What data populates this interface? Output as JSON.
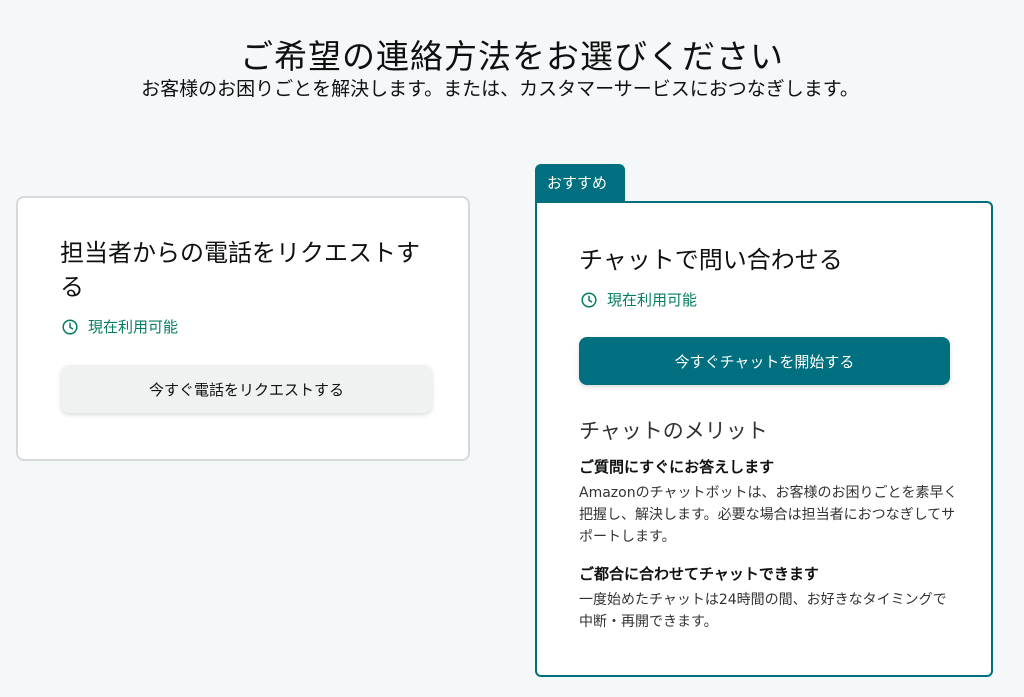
{
  "header": {
    "title": "ご希望の連絡方法をお選びください",
    "subtitle": "お客様のお困りごとを解決します。または、カスタマーサービスにおつなぎします。"
  },
  "phone_card": {
    "title": "担当者からの電話をリクエストする",
    "availability": "現在利用可能",
    "button_label": "今すぐ電話をリクエストする"
  },
  "chat_card": {
    "badge": "おすすめ",
    "title": "チャットで問い合わせる",
    "availability": "現在利用可能",
    "button_label": "今すぐチャットを開始する",
    "benefits_heading": "チャットのメリット",
    "benefits": [
      {
        "title": "ご質問にすぐにお答えします",
        "description": "Amazonのチャットボットは、お客様のお困りごとを素早く把握し、解決します。必要な場合は担当者におつなぎしてサポートします。"
      },
      {
        "title": "ご都合に合わせてチャットできます",
        "description": "一度始めたチャットは24時間の間、お好きなタイミングで中断・再開できます。"
      }
    ]
  },
  "icons": {
    "availability": "clock-icon"
  },
  "colors": {
    "accent": "#006f7f",
    "available": "#067d62",
    "page_background": "#f4f8f9",
    "secondary_button": "#f0f2f2",
    "card_border": "#d5d9d9"
  }
}
